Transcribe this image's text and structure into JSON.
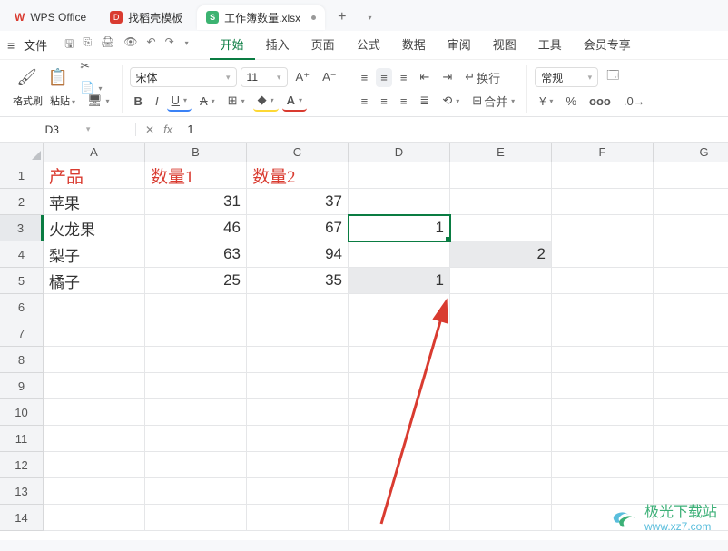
{
  "titleTabs": {
    "wps": "WPS Office",
    "daoke": "找稻壳模板",
    "workbook": "工作簿数量.xlsx"
  },
  "menu": {
    "file": "文件",
    "items": [
      "开始",
      "插入",
      "页面",
      "公式",
      "数据",
      "审阅",
      "视图",
      "工具",
      "会员专享"
    ],
    "activeIndex": 0
  },
  "toolbar": {
    "formatPainter": "格式刷",
    "paste": "粘贴",
    "font": "宋体",
    "fontSize": "11",
    "wrap": "换行",
    "merge": "合并",
    "numberFormat": "常规",
    "currency": "¥"
  },
  "nameBox": "D3",
  "fxLabel": "fx",
  "formulaValue": "1",
  "columns": [
    "A",
    "B",
    "C",
    "D",
    "E",
    "F",
    "G"
  ],
  "rowCount": 14,
  "activeRow": 3,
  "activeCell": {
    "row": 3,
    "col": 4
  },
  "sheet": {
    "r1": {
      "A": "产品",
      "B": "数量1",
      "C": "数量2"
    },
    "r2": {
      "A": "苹果",
      "B": "31",
      "C": "37"
    },
    "r3": {
      "A": "火龙果",
      "B": "46",
      "C": "67",
      "D": "1"
    },
    "r4": {
      "A": "梨子",
      "B": "63",
      "C": "94",
      "E": "2"
    },
    "r5": {
      "A": "橘子",
      "B": "25",
      "C": "35",
      "D": "1"
    }
  },
  "watermark": {
    "line1": "极光下载站",
    "line2": "www.xz7.com"
  }
}
